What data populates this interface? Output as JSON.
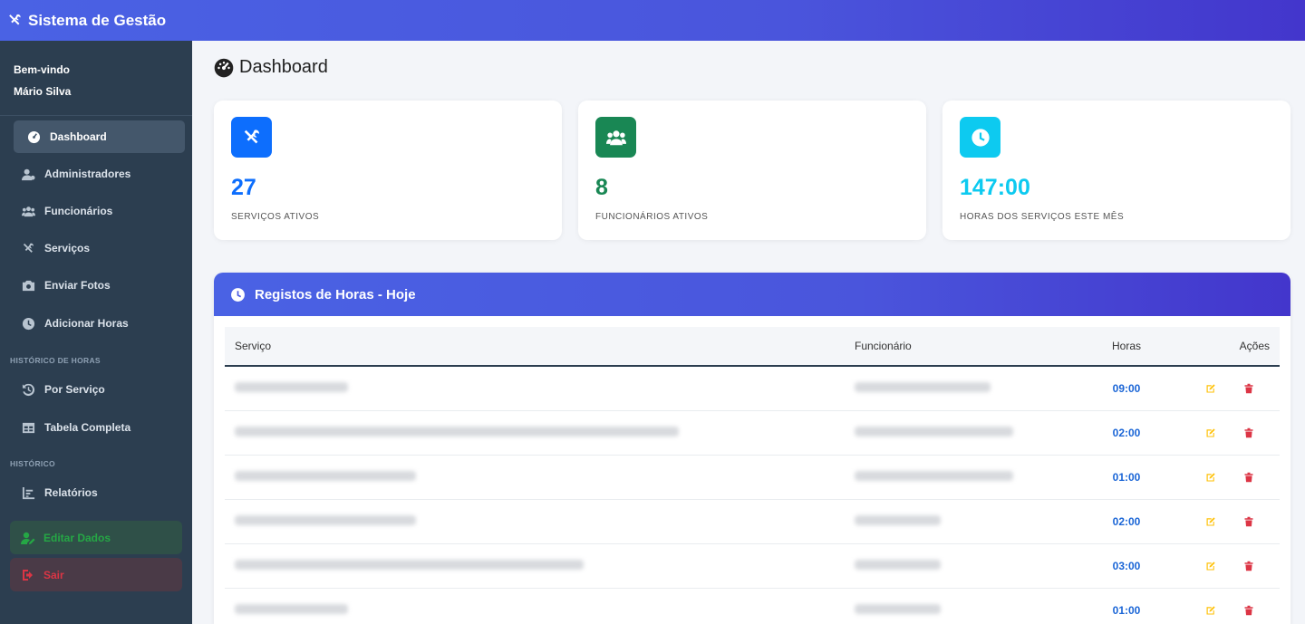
{
  "app": {
    "title": "Sistema de Gestão"
  },
  "user": {
    "greeting": "Bem-vindo",
    "name": "Mário Silva"
  },
  "sidebar": {
    "items": [
      {
        "label": "Dashboard",
        "icon": "dashboard-icon"
      },
      {
        "label": "Administradores",
        "icon": "user-cog-icon"
      },
      {
        "label": "Funcionários",
        "icon": "users-icon"
      },
      {
        "label": "Serviços",
        "icon": "tools-icon"
      },
      {
        "label": "Enviar Fotos",
        "icon": "camera-icon"
      },
      {
        "label": "Adicionar Horas",
        "icon": "clock-icon"
      },
      {
        "label": "Por Serviço",
        "icon": "history-icon"
      },
      {
        "label": "Tabela Completa",
        "icon": "table-icon"
      },
      {
        "label": "Relatórios",
        "icon": "chart-icon"
      }
    ],
    "section_hours": "HISTÓRICO DE HORAS",
    "section_history": "HISTÓRICO",
    "edit_label": "Editar Dados",
    "logout_label": "Sair"
  },
  "page": {
    "title": "Dashboard"
  },
  "stats": [
    {
      "value": "27",
      "label": "SERVIÇOS ATIVOS",
      "color": "#0d6efd",
      "icon": "tools-icon"
    },
    {
      "value": "8",
      "label": "FUNCIONÁRIOS ATIVOS",
      "color": "#198754",
      "icon": "users-icon"
    },
    {
      "value": "147:00",
      "label": "HORAS DOS SERVIÇOS ESTE MÊS",
      "color": "#0dcaf0",
      "icon": "clock-icon"
    }
  ],
  "panel": {
    "title": "Registos de Horas - Hoje",
    "columns": [
      "Serviço",
      "Funcionário",
      "Horas",
      "Ações"
    ],
    "rows": [
      {
        "hours": "09:00"
      },
      {
        "hours": "02:00"
      },
      {
        "hours": "01:00"
      },
      {
        "hours": "02:00"
      },
      {
        "hours": "03:00"
      },
      {
        "hours": "01:00"
      }
    ]
  },
  "colors": {
    "accent": "#4a55dc",
    "sidebar": "#2c3e50",
    "hours": "#1a65d6",
    "edit": "#ffc107",
    "delete": "#dc3545"
  }
}
